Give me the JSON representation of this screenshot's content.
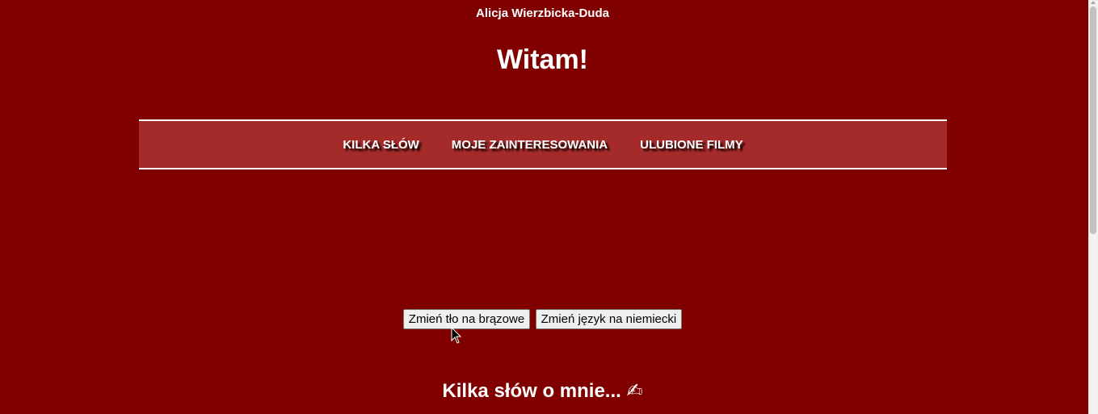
{
  "header": {
    "author": "Alicja Wierzbicka-Duda",
    "title": "Witam!"
  },
  "nav": {
    "items": [
      {
        "label": "KILKA SŁÓW"
      },
      {
        "label": "MOJE ZAINTERESOWANIA"
      },
      {
        "label": "ULUBIONE FILMY"
      }
    ]
  },
  "controls": {
    "bg_button_label": "Zmień tło na brązowe",
    "lang_button_label": "Zmień język na niemiecki"
  },
  "section": {
    "heading": "Kilka słów o mnie... ✍"
  },
  "colors": {
    "background": "#800000",
    "nav_background": "#a52a2a",
    "text": "#ffffff"
  },
  "icons": {
    "heading_icon": "writing-hand-icon"
  }
}
